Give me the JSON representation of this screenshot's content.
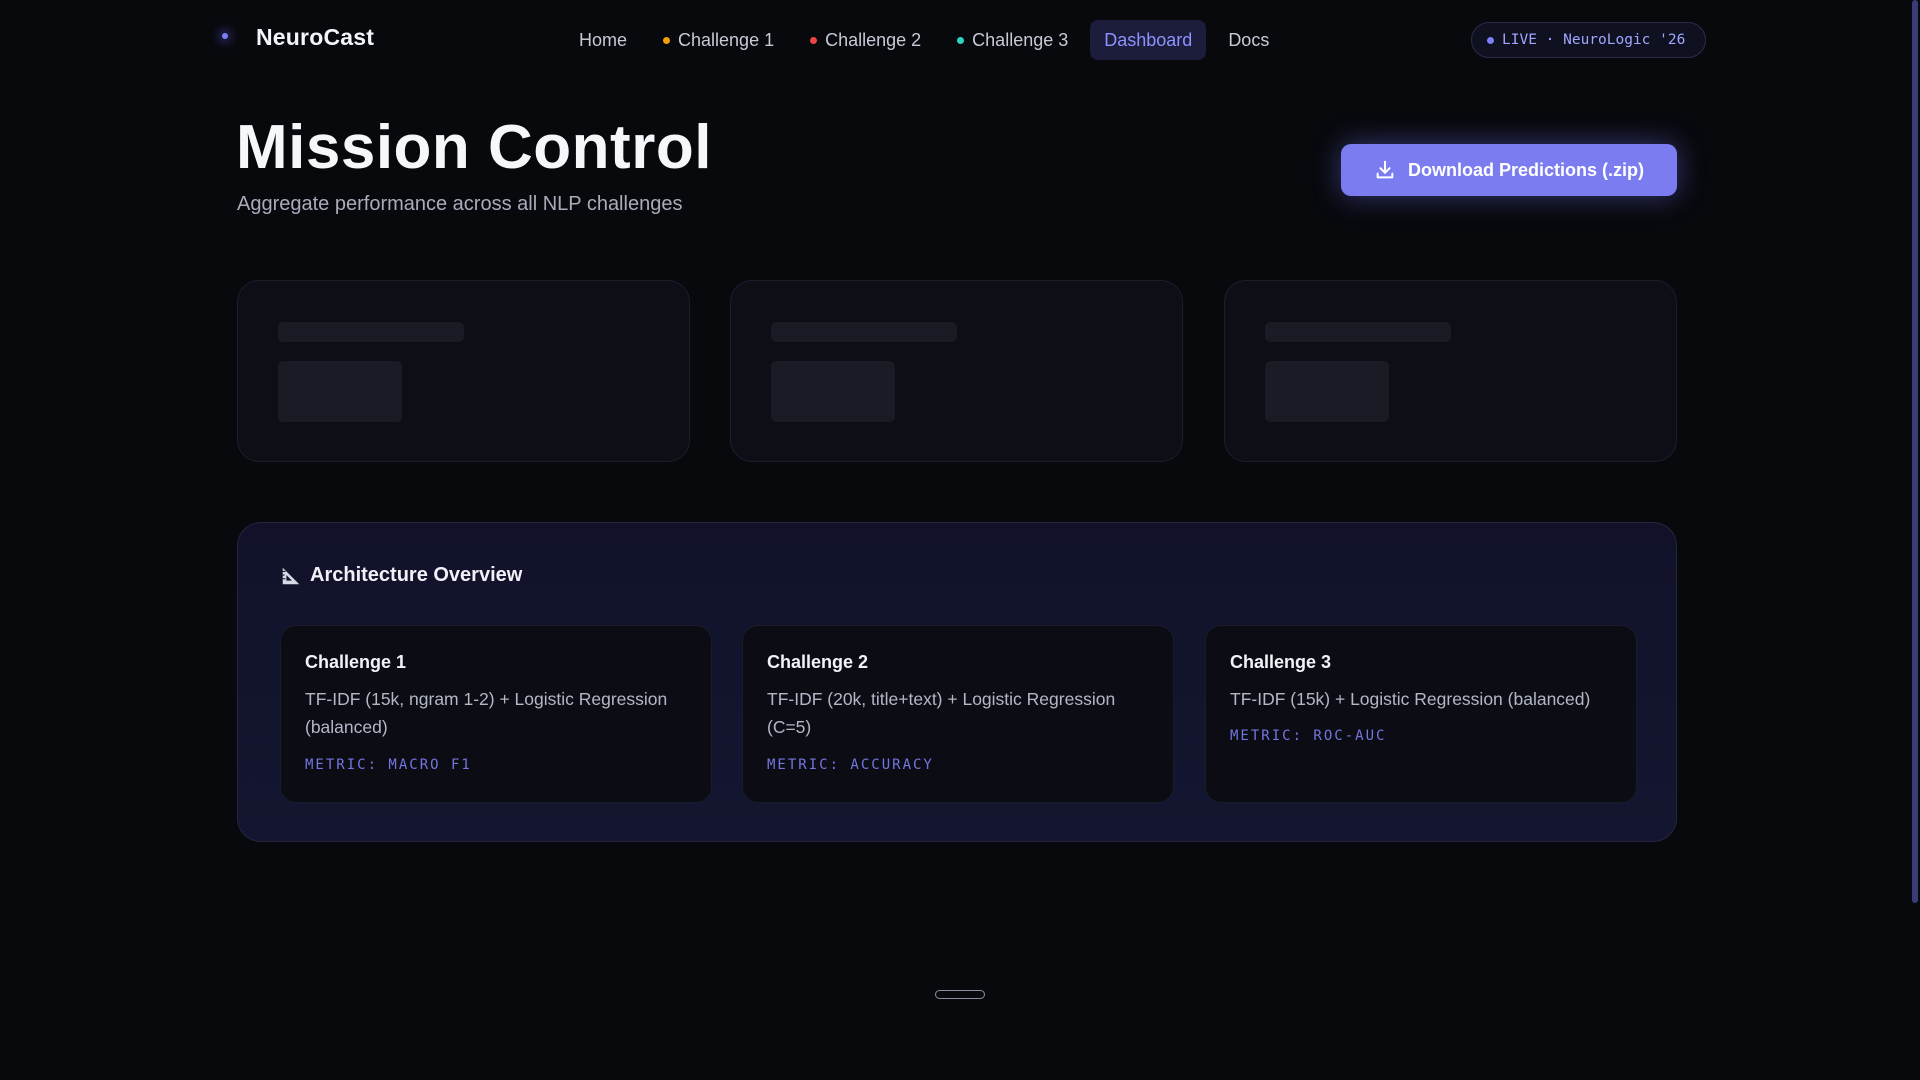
{
  "brand": {
    "name": "NeuroCast"
  },
  "nav": {
    "items": [
      {
        "label": "Home",
        "dot_color": null,
        "active": false
      },
      {
        "label": "Challenge 1",
        "dot_color": "#f59e0b",
        "active": false
      },
      {
        "label": "Challenge 2",
        "dot_color": "#ef4444",
        "active": false
      },
      {
        "label": "Challenge 3",
        "dot_color": "#2dd4bf",
        "active": false
      },
      {
        "label": "Dashboard",
        "dot_color": null,
        "active": true
      },
      {
        "label": "Docs",
        "dot_color": null,
        "active": false
      }
    ],
    "live_badge": "LIVE · NeuroLogic '26"
  },
  "header": {
    "title": "Mission Control",
    "subtitle": "Aggregate performance across all NLP challenges",
    "download_label": "Download Predictions (.zip)"
  },
  "stats": {
    "cards": [
      {
        "state": "loading"
      },
      {
        "state": "loading"
      },
      {
        "state": "loading"
      }
    ]
  },
  "architecture": {
    "title": "Architecture Overview",
    "icon": "ruler-triangle-icon",
    "cards": [
      {
        "title": "Challenge 1",
        "description": "TF-IDF (15k, ngram 1-2) + Logistic Regression (balanced)",
        "metric": "METRIC: MACRO F1"
      },
      {
        "title": "Challenge 2",
        "description": "TF-IDF (20k, title+text) + Logistic Regression (C=5)",
        "metric": "METRIC: ACCURACY"
      },
      {
        "title": "Challenge 3",
        "description": "TF-IDF (15k) + Logistic Regression (balanced)",
        "metric": "METRIC: ROC-AUC"
      }
    ]
  },
  "colors": {
    "accent": "#7a7cf0",
    "background": "#08090d",
    "panel": "#12132c"
  }
}
